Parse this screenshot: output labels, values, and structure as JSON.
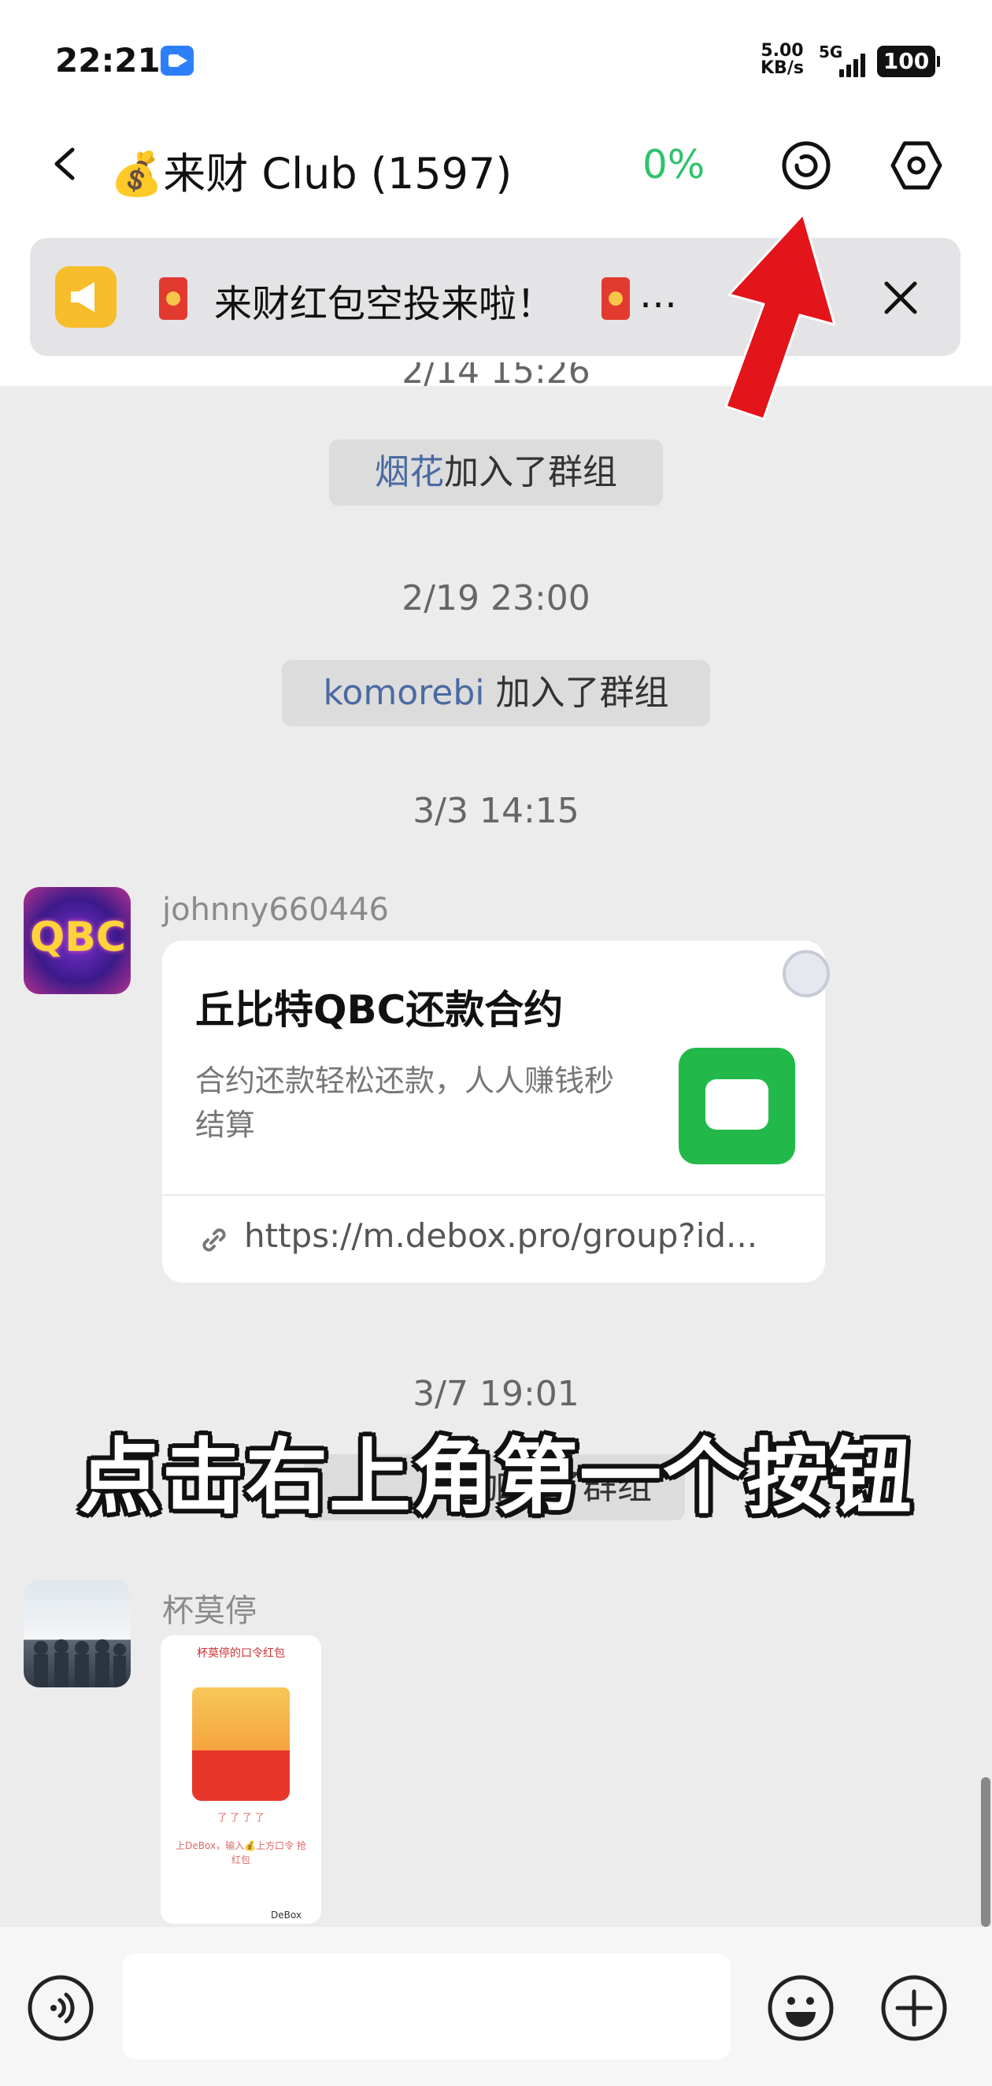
{
  "status_bar": {
    "time": "22:21",
    "speed_value": "5.00",
    "speed_unit": "KB/s",
    "network": "5G",
    "battery": "100"
  },
  "header": {
    "title": "💰来财 Club (1597)",
    "progress": "0%"
  },
  "notice": {
    "text": "来财红包空投来啦！",
    "ellipsis": "…"
  },
  "chat": {
    "partial_timestamp": "2/14 15:26",
    "messages": [
      {
        "name": "烟花",
        "action": "加入了群组"
      },
      {
        "timestamp": "2/19 23:00"
      },
      {
        "name": "komorebi",
        "action": " 加入了群组"
      },
      {
        "timestamp": "3/3 14:15"
      }
    ],
    "post": {
      "username": "johnny660446",
      "avatar_text": "QBC",
      "card_title": "丘比特QBC还款合约",
      "card_desc": "合约还款轻松还款，人人赚钱秒结算",
      "card_link": "https://m.debox.pro/group?id..."
    },
    "timestamp2": "3/7 19:01",
    "sys3_partial": "加入了群组",
    "post2": {
      "username": "杯莫停",
      "img_title": "杯莫停的口令红包",
      "img_stars": "了 了 了 了",
      "img_caption": "上DeBox，输入💰上方口令 抢红包",
      "img_footer": "DeBox"
    }
  },
  "overlay_caption": "点击右上角第一个按钮",
  "colors": {
    "accent_green": "#2ec36c",
    "arrow_red": "#e3141a",
    "name_blue": "#4a6aa3"
  },
  "icons": [
    "back-icon",
    "refresh-icon",
    "settings-icon",
    "megaphone-icon",
    "red-packet-icon",
    "close-icon",
    "link-icon",
    "voice-icon",
    "emoji-icon",
    "plus-icon"
  ]
}
